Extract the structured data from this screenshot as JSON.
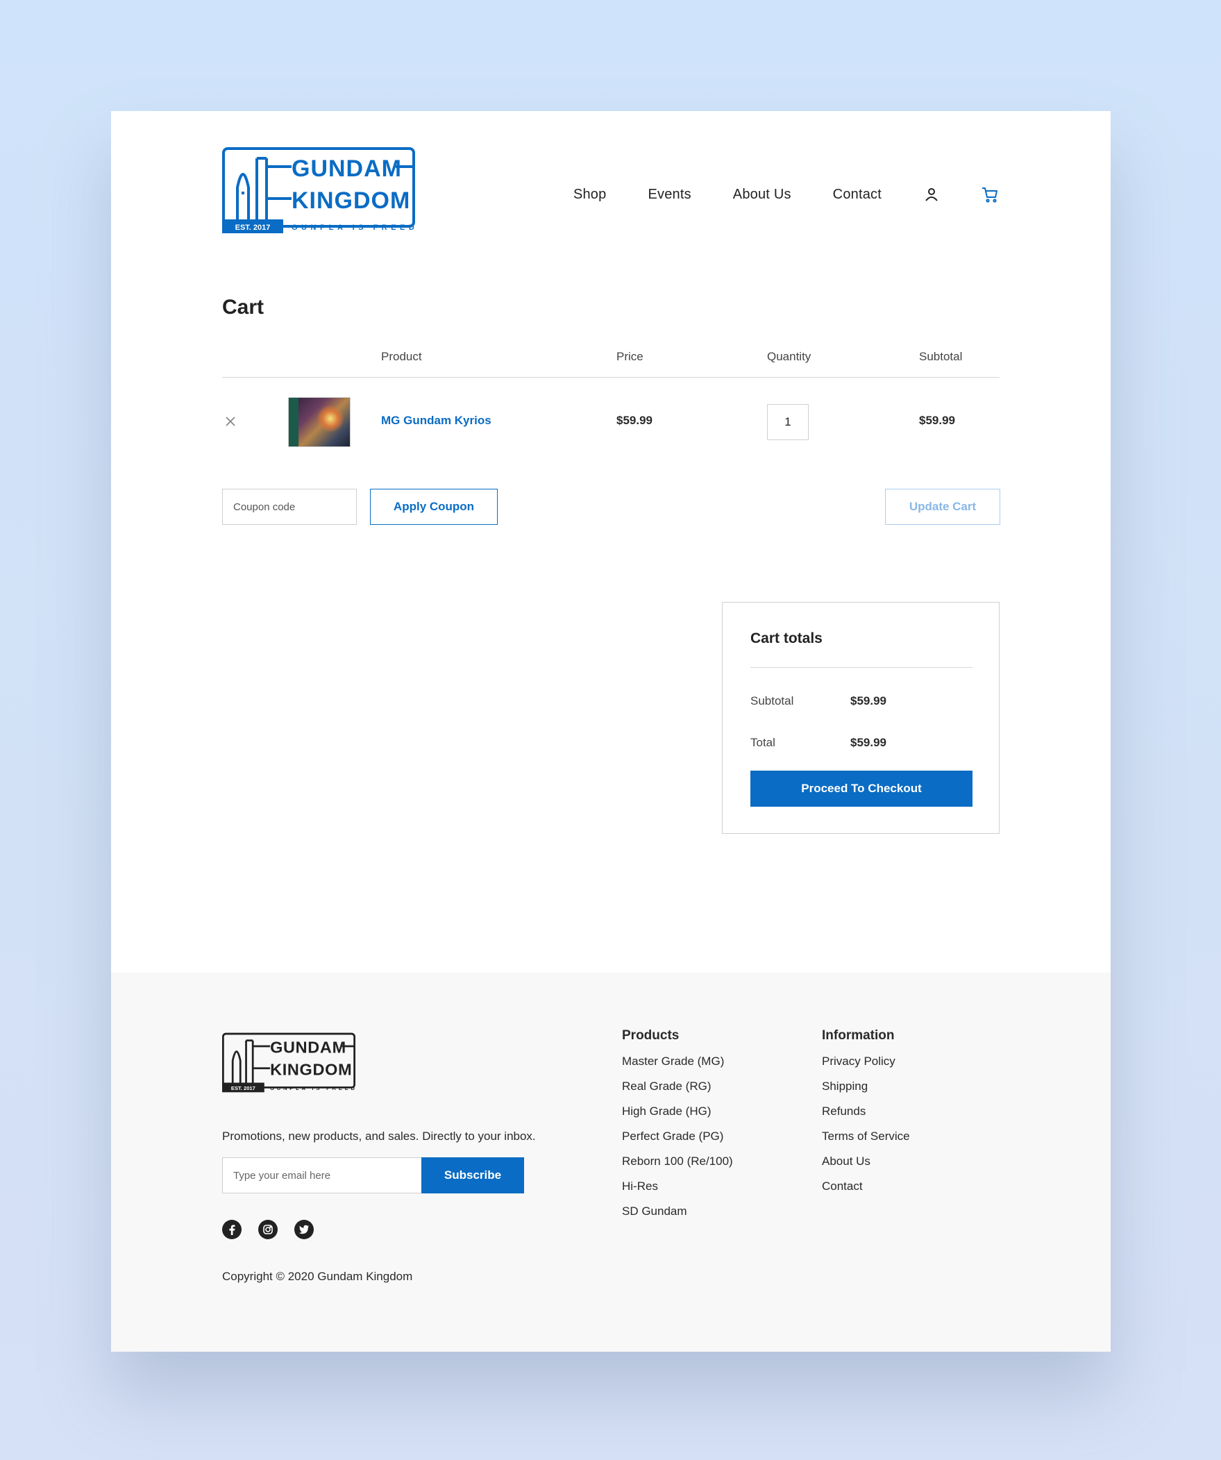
{
  "brand": {
    "name_line1": "GUNDAM",
    "name_line2": "KINGDOM",
    "est": "EST. 2017",
    "tagline": "GUNPLA IS FREEDOM",
    "color": "#0a6cc4"
  },
  "nav": {
    "items": [
      "Shop",
      "Events",
      "About Us",
      "Contact"
    ],
    "account_icon": "user-icon",
    "cart_icon": "cart-icon"
  },
  "cart": {
    "title": "Cart",
    "columns": {
      "product": "Product",
      "price": "Price",
      "quantity": "Quantity",
      "subtotal": "Subtotal"
    },
    "items": [
      {
        "name": "MG Gundam Kyrios",
        "price": "$59.99",
        "quantity": "1",
        "subtotal": "$59.99"
      }
    ],
    "coupon_placeholder": "Coupon code",
    "apply_coupon_label": "Apply Coupon",
    "update_cart_label": "Update Cart"
  },
  "totals": {
    "title": "Cart totals",
    "subtotal_label": "Subtotal",
    "subtotal_value": "$59.99",
    "total_label": "Total",
    "total_value": "$59.99",
    "checkout_label": "Proceed To Checkout"
  },
  "footer": {
    "newsletter_text": "Promotions, new products, and sales. Directly to your inbox.",
    "email_placeholder": "Type your email here",
    "subscribe_label": "Subscribe",
    "social": [
      "facebook-icon",
      "instagram-icon",
      "twitter-icon"
    ],
    "copyright": "Copyright © 2020 Gundam Kingdom",
    "products": {
      "title": "Products",
      "links": [
        "Master Grade (MG)",
        "Real Grade (RG)",
        "High Grade (HG)",
        "Perfect Grade (PG)",
        "Reborn 100 (Re/100)",
        "Hi-Res",
        "SD Gundam"
      ]
    },
    "information": {
      "title": "Information",
      "links": [
        "Privacy Policy",
        "Shipping",
        "Refunds",
        "Terms of Service",
        "About Us",
        "Contact"
      ]
    }
  }
}
